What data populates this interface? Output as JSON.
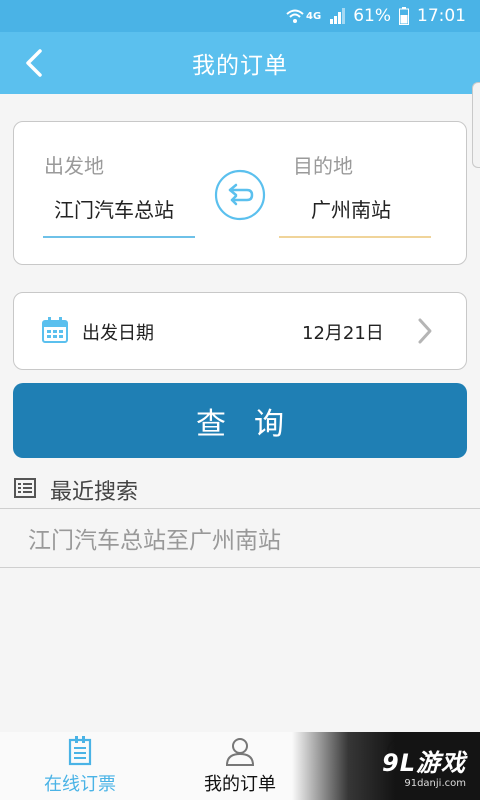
{
  "status_bar": {
    "network": "4G",
    "battery": "61%",
    "time": "17:01"
  },
  "header": {
    "title": "我的订单",
    "back_icon": "chevron-left-icon"
  },
  "stations": {
    "from_label": "出发地",
    "from_value": "江门汽车总站",
    "to_label": "目的地",
    "to_value": "广州南站",
    "swap_icon": "swap-route-icon",
    "from_line_color": "#6ec1e8",
    "to_line_color": "#f0d49a"
  },
  "date": {
    "label": "出发日期",
    "value": "12月21日",
    "icon": "calendar-icon"
  },
  "search_button": {
    "label": "查询",
    "color": "#1f7fb4"
  },
  "recent": {
    "title": "最近搜索",
    "icon": "list-icon",
    "items": [
      "江门汽车总站至广州南站"
    ]
  },
  "tabs": [
    {
      "label": "在线订票",
      "icon": "ticket-icon",
      "active": true
    },
    {
      "label": "我的订单",
      "icon": "user-icon",
      "active": false
    },
    {
      "label": "",
      "icon": "more-icon",
      "active": false
    }
  ],
  "watermark": {
    "main": "9L游戏",
    "sub": "91danji.com"
  },
  "colors": {
    "header": "#5bc0ee",
    "status_bar": "#4ab3e6",
    "accent": "#4ab3e6"
  }
}
